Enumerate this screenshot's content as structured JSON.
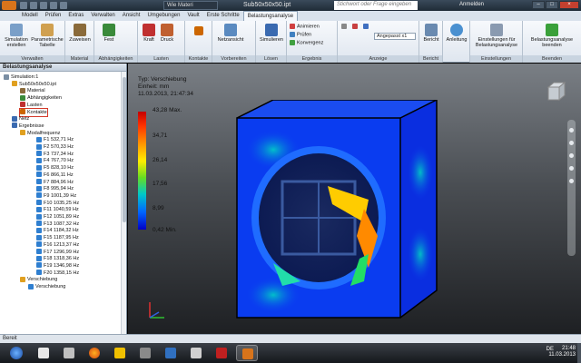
{
  "window": {
    "material": "Wie Materi",
    "document_title": "Sub50x50x50.ipt",
    "search_placeholder": "Stichwort oder Frage eingeben",
    "signin": "Anmelden"
  },
  "ribbon_tabs": [
    "Modell",
    "Prüfen",
    "Extras",
    "Verwalten",
    "Ansicht",
    "Umgebungen",
    "Vault",
    "Erste Schritte",
    "Belastungsanalyse"
  ],
  "ribbon": {
    "groups": {
      "verwalten": "Verwalten",
      "material": "Material",
      "abhaengigkeiten": "Abhängigkeiten",
      "lasten": "Lasten",
      "kontakte": "Kontakte",
      "vorbereiten": "Vorbereiten",
      "loesen": "Lösen",
      "ergebnis": "Ergebnis",
      "anzeige": "Anzeige",
      "einstellungen": "Einstellungen",
      "beenden": "Beenden"
    },
    "buttons": {
      "simulation": "Simulation erstellen",
      "param_table": "Parametrische Tabelle",
      "assign": "Zuweisen",
      "fixed": "Fest",
      "force": "Kraft",
      "pressure": "Druck",
      "mesh_view": "Netzansicht",
      "simulate": "Simulieren",
      "animate": "Animieren",
      "probe": "Prüfen",
      "convergence": "Konvergenz",
      "scale_dropdown": "Angepasst x1",
      "report": "Bericht",
      "guide": "Anleitung",
      "settings": "Einstellungen für Belastungsanalyse",
      "finish": "Belastungsanalyse beenden",
      "report_group": "Bericht"
    }
  },
  "browser": {
    "title": "Belastungsanalyse",
    "tree": [
      {
        "label": "Simulation:1",
        "indent": 0,
        "icon": "#7a8ea3"
      },
      {
        "label": "Sub50x50x50.ipt",
        "indent": 1,
        "icon": "#e0a020"
      },
      {
        "label": "Material",
        "indent": 2,
        "icon": "#8a6a3a"
      },
      {
        "label": "Abhängigkeiten",
        "indent": 2,
        "icon": "#3a8a3a"
      },
      {
        "label": "Lasten",
        "indent": 2,
        "icon": "#c03030"
      },
      {
        "label": "Kontakte",
        "indent": 2,
        "icon": "#cc6600"
      },
      {
        "label": "Netz",
        "indent": 1,
        "icon": "#3a6ab0"
      },
      {
        "label": "Ergebnisse",
        "indent": 1,
        "icon": "#3a6ab0"
      },
      {
        "label": "Modalfrequenz",
        "indent": 2,
        "icon": "#e0a020"
      },
      {
        "label": "F1 532,71 Hz",
        "indent": 4,
        "icon": "#2f7fd0"
      },
      {
        "label": "F2 570,33 Hz",
        "indent": 4,
        "icon": "#2f7fd0"
      },
      {
        "label": "F3 737,34 Hz",
        "indent": 4,
        "icon": "#2f7fd0"
      },
      {
        "label": "F4 767,70 Hz",
        "indent": 4,
        "icon": "#2f7fd0"
      },
      {
        "label": "F5 828,10 Hz",
        "indent": 4,
        "icon": "#2f7fd0"
      },
      {
        "label": "F6 866,11 Hz",
        "indent": 4,
        "icon": "#2f7fd0"
      },
      {
        "label": "F7 884,96 Hz",
        "indent": 4,
        "icon": "#2f7fd0"
      },
      {
        "label": "F8 995,94 Hz",
        "indent": 4,
        "icon": "#2f7fd0"
      },
      {
        "label": "F9 1001,39 Hz",
        "indent": 4,
        "icon": "#2f7fd0"
      },
      {
        "label": "F10 1035,25 Hz",
        "indent": 4,
        "icon": "#2f7fd0"
      },
      {
        "label": "F11 1040,59 Hz",
        "indent": 4,
        "icon": "#2f7fd0"
      },
      {
        "label": "F12 1051,89 Hz",
        "indent": 4,
        "icon": "#2f7fd0"
      },
      {
        "label": "F13 1087,32 Hz",
        "indent": 4,
        "icon": "#2f7fd0"
      },
      {
        "label": "F14 1184,32 Hz",
        "indent": 4,
        "icon": "#2f7fd0"
      },
      {
        "label": "F15 1187,95 Hz",
        "indent": 4,
        "icon": "#2f7fd0"
      },
      {
        "label": "F16 1213,37 Hz",
        "indent": 4,
        "icon": "#2f7fd0"
      },
      {
        "label": "F17 1296,99 Hz",
        "indent": 4,
        "icon": "#2f7fd0"
      },
      {
        "label": "F18 1318,36 Hz",
        "indent": 4,
        "icon": "#2f7fd0"
      },
      {
        "label": "F19 1346,98 Hz",
        "indent": 4,
        "icon": "#2f7fd0"
      },
      {
        "label": "F20 1358,15 Hz",
        "indent": 4,
        "icon": "#2f7fd0"
      },
      {
        "label": "Verschiebung",
        "indent": 2,
        "icon": "#e0a020"
      },
      {
        "label": "Verschiebung",
        "indent": 3,
        "icon": "#2f7fd0"
      }
    ]
  },
  "viewport": {
    "type_line": "Typ: Verschiebung",
    "unit_line": "Einheit: mm",
    "date_line": "11.03.2013, 21:47:34",
    "legend_max": "43,28 Max.",
    "legend_ticks": [
      "34,71",
      "26,14",
      "17,56",
      "8,99"
    ],
    "legend_min": "0,42 Min."
  },
  "status": {
    "text": "Bereit"
  },
  "taskbar": {
    "language": "DE",
    "time": "21:48",
    "date": "11.03.2013"
  },
  "colors": {
    "model_blue": "#0a3cf0",
    "accent": "#d8741b"
  }
}
